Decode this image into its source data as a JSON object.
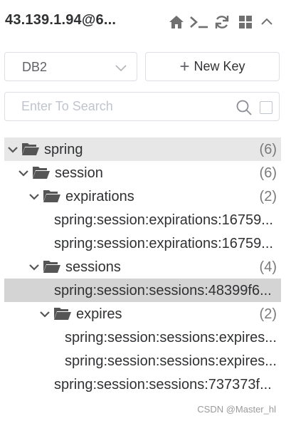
{
  "header": {
    "title": "43.139.1.94@6...",
    "icons": [
      "home-icon",
      "terminal-icon",
      "refresh-icon",
      "grid-icon",
      "collapse-icon"
    ]
  },
  "toolbar": {
    "db_value": "DB2",
    "new_key_plus": "+",
    "new_key_label": "New Key"
  },
  "search": {
    "placeholder": "Enter To Search",
    "value": ""
  },
  "tree": {
    "spring": {
      "name": "spring",
      "count": "(6)"
    },
    "session": {
      "name": "session",
      "count": "(6)"
    },
    "expirations": {
      "name": "expirations",
      "count": "(2)"
    },
    "exp_key1": "spring:session:expirations:16759...",
    "exp_key2": "spring:session:expirations:16759...",
    "sessions": {
      "name": "sessions",
      "count": "(4)"
    },
    "sess_key1": "spring:session:sessions:48399f6...",
    "expires": {
      "name": "expires",
      "count": "(2)"
    },
    "expires_key1": "spring:session:sessions:expires...",
    "expires_key2": "spring:session:sessions:expires...",
    "sess_key2": "spring:session:sessions:737373f..."
  },
  "watermark": "CSDN @Master_hl",
  "colors": {
    "text": "#303133",
    "muted": "#7a7a7a",
    "border": "#dcdfe6",
    "selected_row": "#d4d4d4",
    "highlight_row": "#e7e7e7"
  }
}
